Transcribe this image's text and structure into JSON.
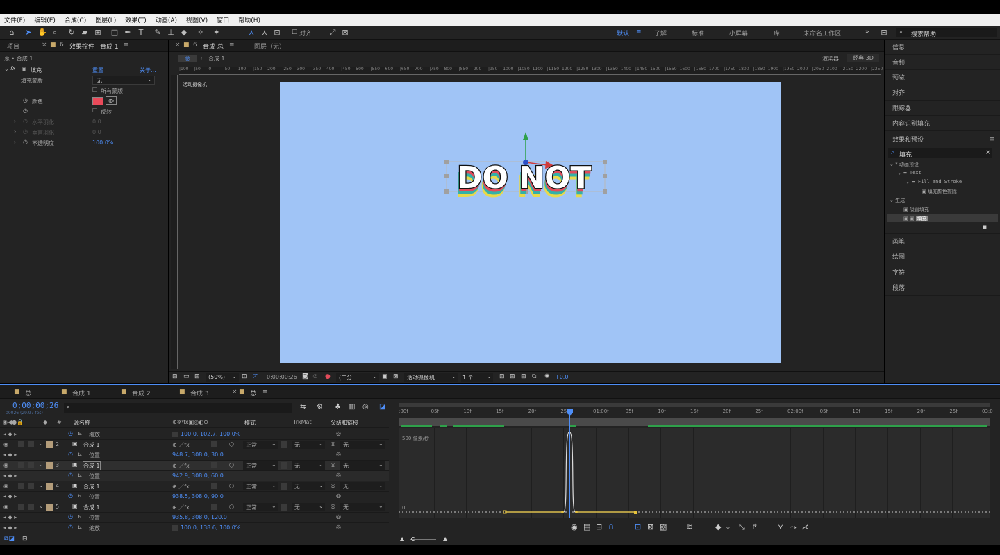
{
  "menu": [
    "文件(F)",
    "编辑(E)",
    "合成(C)",
    "图层(L)",
    "效果(T)",
    "动画(A)",
    "视图(V)",
    "窗口",
    "帮助(H)"
  ],
  "toolbar": {
    "align_label": "对齐",
    "workspaces": [
      "默认",
      "了解",
      "标准",
      "小屏幕",
      "库",
      "未命名工作区"
    ],
    "search_placeholder": "搜索帮助"
  },
  "effects_panel": {
    "tab_project": "项目",
    "tab_effects": "效果控件",
    "tab_effects_target": "合成 1",
    "breadcrumb": "总 • 合成 1",
    "effect_name": "填充",
    "reset": "重置",
    "about": "关于...",
    "rows": {
      "fill_mask": "填充蒙版",
      "fill_mask_value": "无",
      "all_masks": "所有蒙版",
      "color": "颜色",
      "color_value": "#ea4a5a",
      "invert": "反转",
      "h_feather": "水平羽化",
      "h_feather_value": "0.0",
      "v_feather": "垂直羽化",
      "v_feather_value": "0.0",
      "opacity": "不透明度",
      "opacity_value": "100.0%"
    }
  },
  "comp_panel": {
    "tab_comp": "合成 总",
    "tab_layer": "图层（无）",
    "crumb_total": "总",
    "crumb_comp": "合成 1",
    "renderer_label": "渲染器",
    "renderer_value": "经典 3D",
    "camera_label": "活动摄像机",
    "canvas_text": "DO NOT",
    "ruler_ticks": [
      "|100",
      "|50",
      "0",
      "|50",
      "100",
      "|150",
      "200",
      "|250",
      "300",
      "|350",
      "400",
      "|450",
      "500",
      "|550",
      "600",
      "|650",
      "700",
      "|750",
      "800",
      "|850",
      "900",
      "|950",
      "1000",
      "|1050",
      "1100",
      "|1150",
      "1200",
      "|1250",
      "1300",
      "|1350",
      "1400",
      "|1450",
      "1500",
      "|1550",
      "1600",
      "|1650",
      "1700",
      "|1750",
      "1800",
      "|1850",
      "1900",
      "|1950",
      "2000",
      "|2050",
      "2100",
      "|2150",
      "2200",
      "|2250"
    ],
    "footer": {
      "zoom": "(50%)",
      "timecode": "0;00;00;26",
      "resolution": "(二分...",
      "camera": "活动摄像机",
      "views": "1 个...",
      "exposure": "+0.0"
    }
  },
  "right_panel": {
    "items_top": [
      "信息",
      "音频",
      "预览",
      "对齐",
      "跟踪器",
      "内容识别填充",
      "效果和预设"
    ],
    "search_value": "填充",
    "tree": {
      "anim_presets": "* 动画预设",
      "text": "Text",
      "fill_stroke": "Fill and Stroke",
      "fill_color_wipe": "填充颜色擦除",
      "generate": "生成",
      "gradient_fill": "吸管填充",
      "fill": "填充"
    },
    "items_bottom": [
      "画笔",
      "绘图",
      "字符",
      "段落"
    ]
  },
  "timeline": {
    "tabs": [
      "总",
      "合成 1",
      "合成 2",
      "合成 3",
      "总"
    ],
    "timecode": "0;00;00;26",
    "fps": "00026 (29.97 fps)",
    "search_placeholder": "",
    "headers": {
      "source_name": "源名称",
      "mode": "模式",
      "t": "T",
      "trkmat": "TrkMat",
      "parent": "父级和链接"
    },
    "rows": [
      {
        "type": "prop",
        "name": "缩放",
        "value": "100.0, 102.7, 100.0%"
      },
      {
        "type": "layer",
        "num": "2",
        "name": "合成 1",
        "mode": "正常",
        "trk": "无",
        "parent": "无"
      },
      {
        "type": "prop",
        "name": "位置",
        "value": "948.7, 308.0, 30.0"
      },
      {
        "type": "layer",
        "num": "3",
        "name": "合成 1",
        "mode": "正常",
        "trk": "无",
        "parent": "无"
      },
      {
        "type": "prop",
        "name": "位置",
        "value": "942.9, 308.0, 60.0"
      },
      {
        "type": "layer",
        "num": "4",
        "name": "合成 1",
        "mode": "正常",
        "trk": "无",
        "parent": "无"
      },
      {
        "type": "prop",
        "name": "位置",
        "value": "938.5, 308.0, 90.0"
      },
      {
        "type": "layer",
        "num": "5",
        "name": "合成 1",
        "mode": "正常",
        "trk": "无",
        "parent": "无"
      },
      {
        "type": "prop",
        "name": "位置",
        "value": "935.8, 308.0, 120.0"
      },
      {
        "type": "prop",
        "name": "缩放",
        "value": "100.0, 138.6, 100.0%"
      }
    ],
    "ruler": [
      ":00f",
      "05f",
      "10f",
      "15f",
      "20f",
      "25f",
      "01:00f",
      "05f",
      "10f",
      "15f",
      "20f",
      "25f",
      "02:00f",
      "05f",
      "10f",
      "15f",
      "20f",
      "25f",
      "03:0"
    ],
    "graph_top_label": "500 像素/秒",
    "graph_zero_label": "0"
  }
}
